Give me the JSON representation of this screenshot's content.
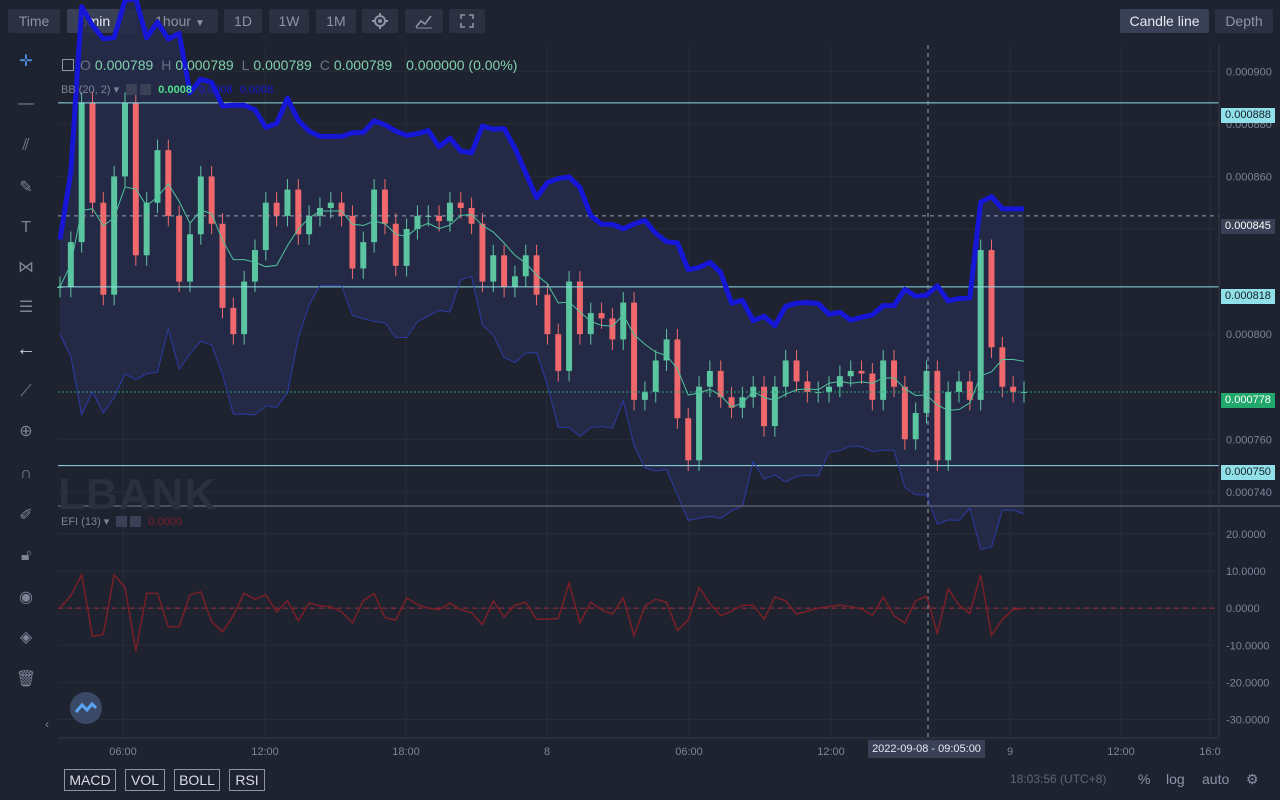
{
  "toolbar": {
    "time_label": "Time",
    "interval_label": "5min",
    "hour_label": "1hour",
    "day_label": "1D",
    "week_label": "1W",
    "month_label": "1M",
    "candle_line_label": "Candle line",
    "depth_label": "Depth"
  },
  "ohlc": {
    "o_key": "O",
    "o_val": "0.000789",
    "h_key": "H",
    "h_val": "0.000789",
    "l_key": "L",
    "l_val": "0.000789",
    "c_key": "C",
    "c_val": "0.000789",
    "change": "0.000000 (0.00%)"
  },
  "indicators": {
    "bb_label": "BB (20, 2)",
    "bb_value": "0.0008",
    "bb_value2": "0.0008",
    "bb_value3": "0.0008",
    "efi_label": "EFI (13)",
    "efi_value": "0.0000"
  },
  "watermark": "LBANK",
  "crosshair": {
    "time_label": "2022-09-08 - 09:05:00",
    "price_label": "0.000845"
  },
  "bottom": {
    "macd": "MACD",
    "vol": "VOL",
    "boll": "BOLL",
    "rsi": "RSI",
    "clock": "18:03:56 (UTC+8)",
    "percent": "%",
    "log": "log",
    "auto": "auto"
  },
  "colors": {
    "up": "#5bc5a0",
    "down": "#f0686b",
    "bb_upper": "#1616d6",
    "bb_mid": "#4fc39c",
    "hline": "#8fe0e8",
    "efi": "#7a1f25",
    "last_price": "#22a86b"
  },
  "chart_data": {
    "type": "candlestick",
    "y_axis_ticks": [
      "0.000900",
      "0.000880",
      "0.000860",
      "0.000840",
      "0.000800",
      "0.000760",
      "0.000740"
    ],
    "x_axis_ticks": [
      "06:00",
      "12:00",
      "18:00",
      "8",
      "06:00",
      "12:00",
      "9",
      "12:00",
      "16:0"
    ],
    "price_lines": [
      "0.000888",
      "0.000818",
      "0.000750"
    ],
    "last_price": "0.000778",
    "ylim": [
      0.000735,
      0.00091
    ],
    "efi_ticks": [
      "20.0000",
      "10.0000",
      "0.0000",
      "-10.0000",
      "-20.0000",
      "-30.0000"
    ],
    "efi_ylim": [
      -35,
      27
    ],
    "candles_close": [
      0.000818,
      0.000835,
      0.000888,
      0.00085,
      0.000815,
      0.00086,
      0.000888,
      0.00083,
      0.00085,
      0.00087,
      0.000845,
      0.00082,
      0.000838,
      0.00086,
      0.000842,
      0.00081,
      0.0008,
      0.00082,
      0.000832,
      0.00085,
      0.000845,
      0.000855,
      0.000838,
      0.000845,
      0.000848,
      0.00085,
      0.000845,
      0.000825,
      0.000835,
      0.000855,
      0.000842,
      0.000826,
      0.00084,
      0.000845,
      0.000845,
      0.000843,
      0.00085,
      0.000848,
      0.000842,
      0.00082,
      0.00083,
      0.000818,
      0.000822,
      0.00083,
      0.000815,
      0.0008,
      0.000786,
      0.00082,
      0.0008,
      0.000808,
      0.000806,
      0.000798,
      0.000812,
      0.000775,
      0.000778,
      0.00079,
      0.000798,
      0.000768,
      0.000752,
      0.00078,
      0.000786,
      0.000776,
      0.000772,
      0.000776,
      0.00078,
      0.000765,
      0.00078,
      0.00079,
      0.000782,
      0.000778,
      0.000778,
      0.00078,
      0.000784,
      0.000786,
      0.000785,
      0.000775,
      0.00079,
      0.00078,
      0.00076,
      0.00077,
      0.000786,
      0.000752,
      0.000778,
      0.000782,
      0.000775,
      0.000832,
      0.000795,
      0.00078,
      0.000778,
      0.000778
    ]
  }
}
